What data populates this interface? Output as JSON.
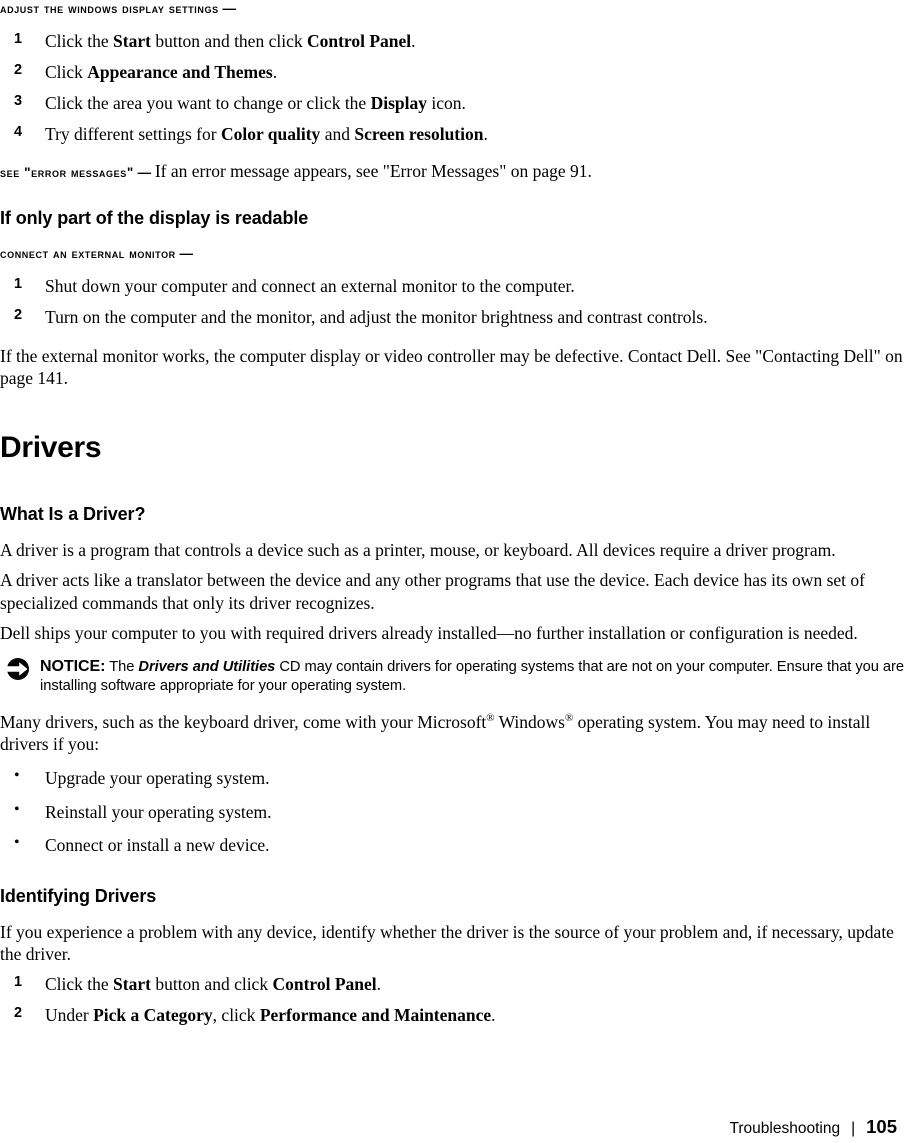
{
  "page": {
    "number": "105",
    "section": "Troubleshooting",
    "separator": "|"
  },
  "blocks": {
    "adjust_display": {
      "heading": "Adjust the Windows display settings",
      "dash": " —",
      "steps": [
        {
          "num": "1",
          "pre": "Click the ",
          "b1": "Start",
          "mid": " button and then click ",
          "b2": "Control Panel",
          "post": "."
        },
        {
          "num": "2",
          "pre": "Click ",
          "b1": "Appearance and Themes",
          "mid": "",
          "b2": "",
          "post": "."
        },
        {
          "num": "3",
          "pre": "Click the area you want to change or click the ",
          "b1": "Display",
          "mid": " icon",
          "b2": "",
          "post": "."
        },
        {
          "num": "4",
          "pre": "Try different settings for ",
          "b1": "Color quality",
          "mid": " and ",
          "b2": "Screen resolution",
          "post": "."
        }
      ]
    },
    "see_error_messages": {
      "heading": "See \"Error Messages\"",
      "dash": " — ",
      "body": "If an error message appears, see \"Error Messages\" on page 91."
    },
    "partial_display": {
      "heading": "If only part of the display is readable"
    },
    "connect_monitor": {
      "heading": "Connect an external monitor",
      "dash": " —",
      "steps": [
        {
          "num": "1",
          "text": "Shut down your computer and connect an external monitor to the computer."
        },
        {
          "num": "2",
          "text": "Turn on the computer and the monitor, and adjust the monitor brightness and contrast controls."
        }
      ],
      "followup": "If the external monitor works, the computer display or video controller may be defective. Contact Dell. See \"Contacting Dell\" on page 141."
    },
    "drivers": {
      "title": "Drivers",
      "what_is": {
        "heading": "What Is a Driver?",
        "para1": "A driver is a program that controls a device such as a printer, mouse, or keyboard. All devices require a driver program.",
        "para2": "A driver acts like a translator between the device and any other programs that use the device. Each device has its own set of specialized commands that only its driver recognizes.",
        "para3": "Dell ships your computer to you with required drivers already installed—no further installation or configuration is needed."
      },
      "notice": {
        "icon": "notice-arrow-icon",
        "label": "NOTICE:",
        "text_before": " The ",
        "italic_title": "Drivers and Utilities",
        "text_after": " CD may contain drivers for operating systems that are not on your computer. Ensure that you are installing software appropriate for your operating system."
      },
      "many_drivers": {
        "part1": "Many drivers, such as the keyboard driver, come with your Microsoft",
        "sup1": "®",
        "part2": " Windows",
        "sup2": "®",
        "part3": " operating system. You may need to install drivers if you:"
      },
      "bullets": [
        "Upgrade your operating system.",
        "Reinstall your operating system.",
        "Connect or install a new device."
      ],
      "identifying": {
        "heading": "Identifying Drivers",
        "intro": "If you experience a problem with any device, identify whether the driver is the source of your problem and, if necessary, update the driver.",
        "steps": [
          {
            "num": "1",
            "pre": "Click the ",
            "b1": "Start",
            "mid": " button and click ",
            "b2": "Control Panel",
            "post": "."
          },
          {
            "num": "2",
            "pre": "Under ",
            "b1": "Pick a Category",
            "mid": ", click ",
            "b2": "Performance and Maintenance",
            "post": "."
          }
        ]
      }
    }
  }
}
